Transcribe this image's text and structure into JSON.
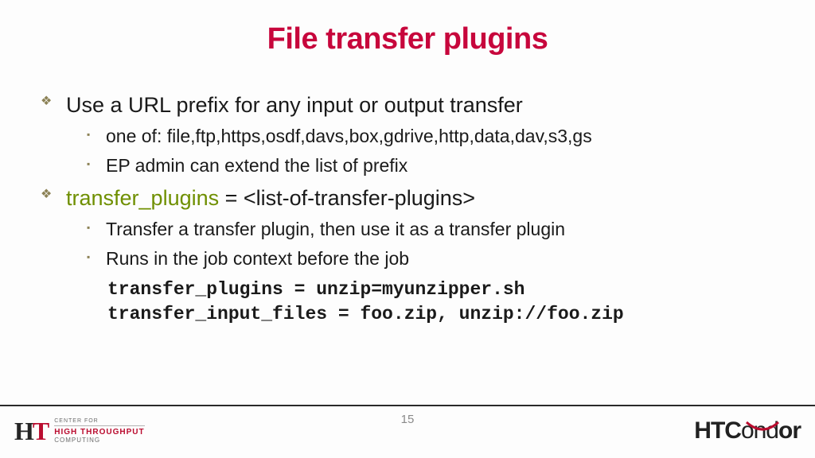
{
  "title": "File transfer plugins",
  "bullets": [
    {
      "text": "Use a URL prefix for any input or output transfer",
      "sub": [
        "one of: file,ftp,https,osdf,davs,box,gdrive,http,data,dav,s3,gs",
        "EP admin can extend the list of prefix"
      ]
    },
    {
      "keyword": "transfer_plugins",
      "rest": " = <list-of-transfer-plugins>",
      "sub": [
        "Transfer a transfer plugin, then use it as a transfer plugin",
        "Runs in the job context before the job"
      ],
      "code": "transfer_plugins = unzip=myunzipper.sh\ntransfer_input_files = foo.zip, unzip://foo.zip"
    }
  ],
  "page_number": "15",
  "footer": {
    "left_logo": {
      "mark": "HT",
      "line1": "CENTER FOR",
      "line2": "HIGH THROUGHPUT",
      "line3": "COMPUTING"
    },
    "right_logo": {
      "bold1": "HTC",
      "thin": "ond",
      "bold2": "or"
    }
  }
}
